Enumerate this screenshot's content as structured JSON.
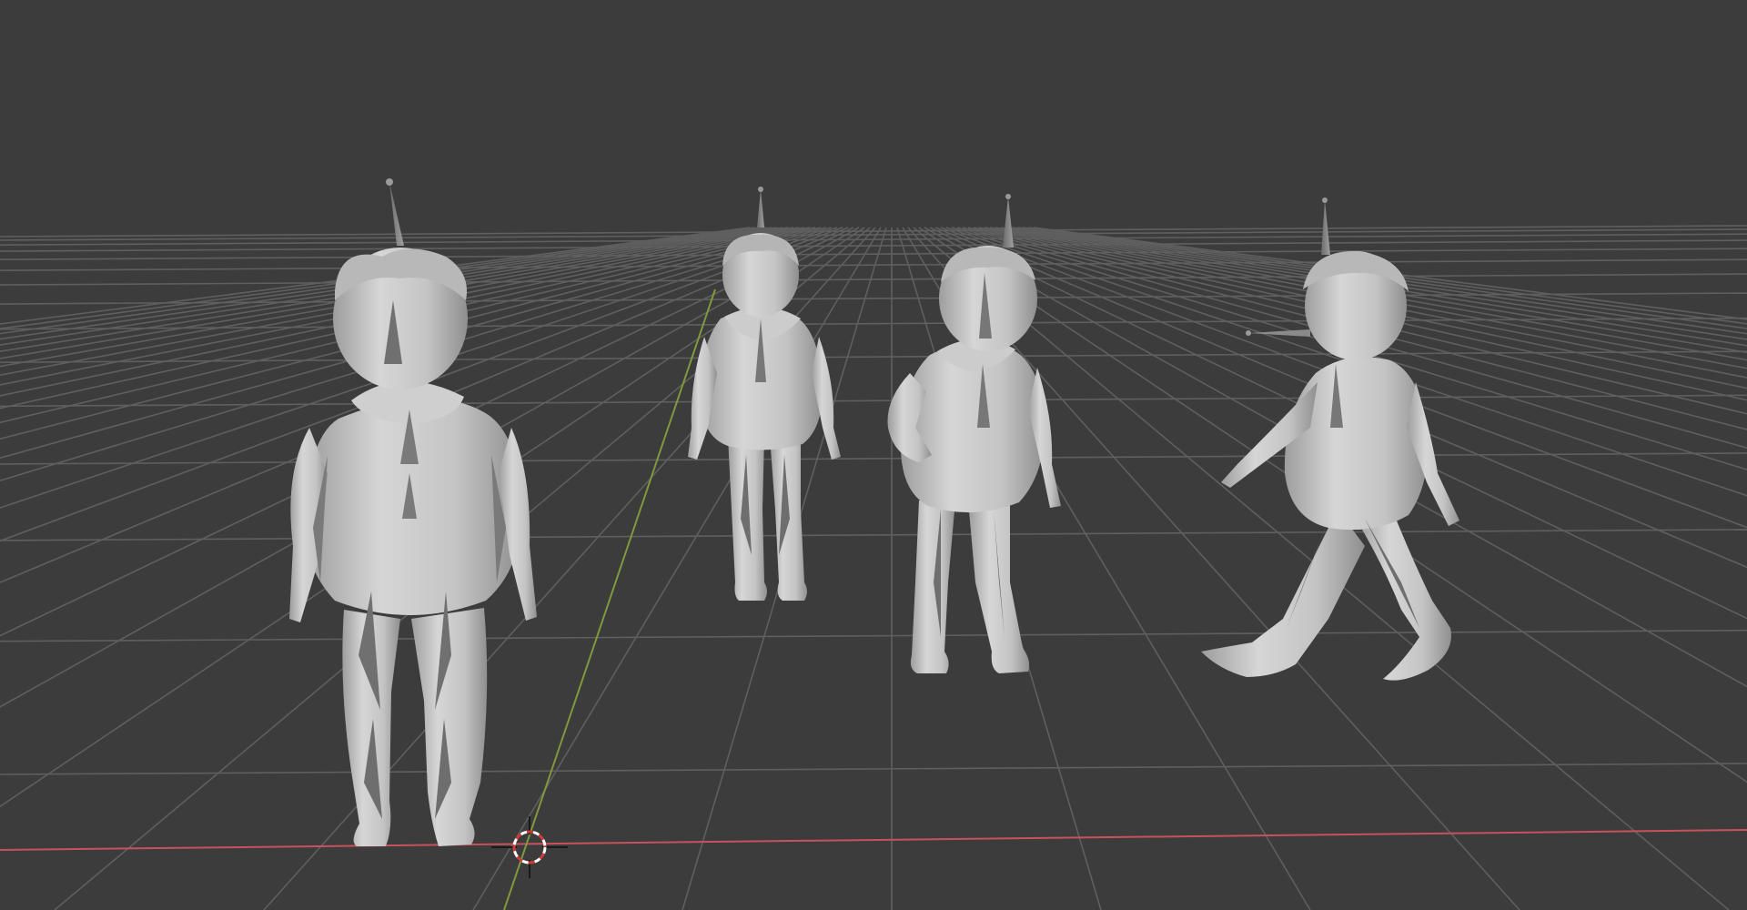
{
  "viewport": {
    "background": "#3c3c3c",
    "grid_color": "#5f5f5f",
    "x_axis_color": "#c8525c",
    "y_axis_color": "#7e9a3c",
    "mesh_color": "#c9c9c9",
    "bone_color": "#8a8a8a"
  },
  "scene": {
    "objects": [
      {
        "kind": "armature-character",
        "pose": "rest-pose-front"
      },
      {
        "kind": "armature-character",
        "pose": "rest-pose-back"
      },
      {
        "kind": "armature-character",
        "pose": "hand-on-hip"
      },
      {
        "kind": "armature-character",
        "pose": "walk-cycle"
      }
    ],
    "cursor_icon": "3d-cursor-icon"
  }
}
